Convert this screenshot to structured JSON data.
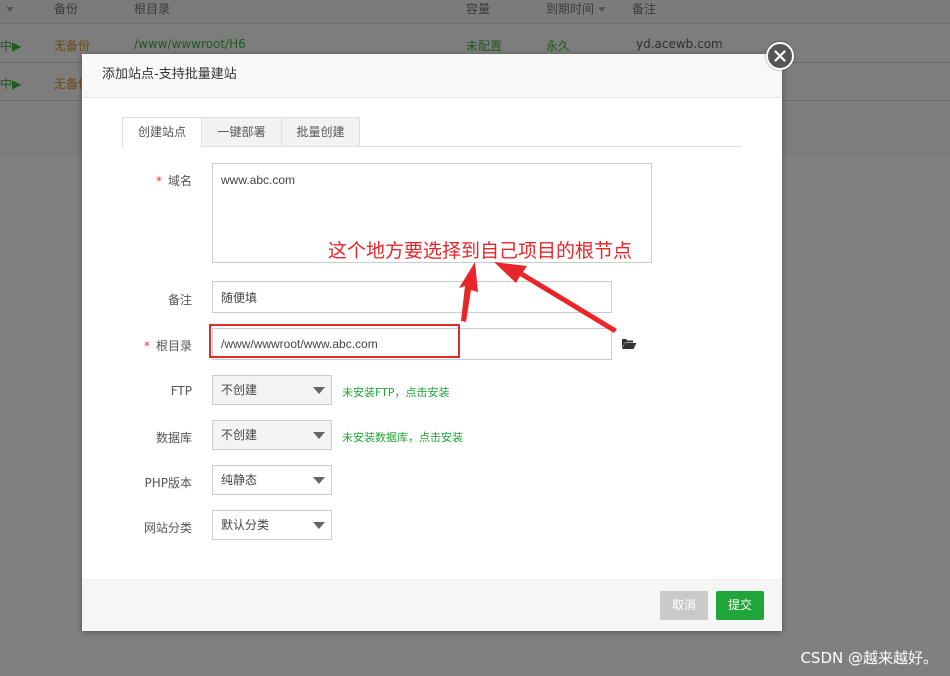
{
  "background": {
    "header": {
      "backup": "备份",
      "root": "根目录",
      "capacity": "容量",
      "expire": "到期时间",
      "note": "备注"
    },
    "rows": [
      {
        "status": "中▶",
        "backup": "无备份",
        "root": "/www/wwwroot/H6",
        "capacity": "未配置",
        "expire": "永久",
        "note": "yd.acewb.com"
      },
      {
        "status": "中▶",
        "backup": "无备份"
      }
    ]
  },
  "dialog": {
    "title": "添加站点-支持批量建站",
    "tabs": [
      {
        "label": "创建站点",
        "active": true
      },
      {
        "label": "一键部署",
        "active": false
      },
      {
        "label": "批量创建",
        "active": false
      }
    ],
    "form": {
      "domain": {
        "label": "域名",
        "value": "www.abc.com"
      },
      "note": {
        "label": "备注",
        "value": "随便填"
      },
      "root": {
        "label": "根目录",
        "value": "/www/wwwroot/www.abc.com"
      },
      "ftp": {
        "label": "FTP",
        "selected": "不创建",
        "hint": "未安装FTP，点击安装"
      },
      "database": {
        "label": "数据库",
        "selected": "不创建",
        "hint": "未安装数据库，点击安装"
      },
      "php": {
        "label": "PHP版本",
        "selected": "纯静态"
      },
      "category": {
        "label": "网站分类",
        "selected": "默认分类"
      }
    },
    "buttons": {
      "cancel": "取消",
      "submit": "提交"
    }
  },
  "annotation": {
    "text": "这个地方要选择到自己项目的根节点",
    "color": "#e8262a"
  },
  "watermark": "CSDN @越来越好。",
  "icons": {
    "close": "close-icon",
    "folder": "folder-open-icon",
    "sort": "sort-caret-icon"
  },
  "colors": {
    "accent": "#20a53a",
    "required": "#e53935",
    "annotation_red": "#e12a2a"
  }
}
